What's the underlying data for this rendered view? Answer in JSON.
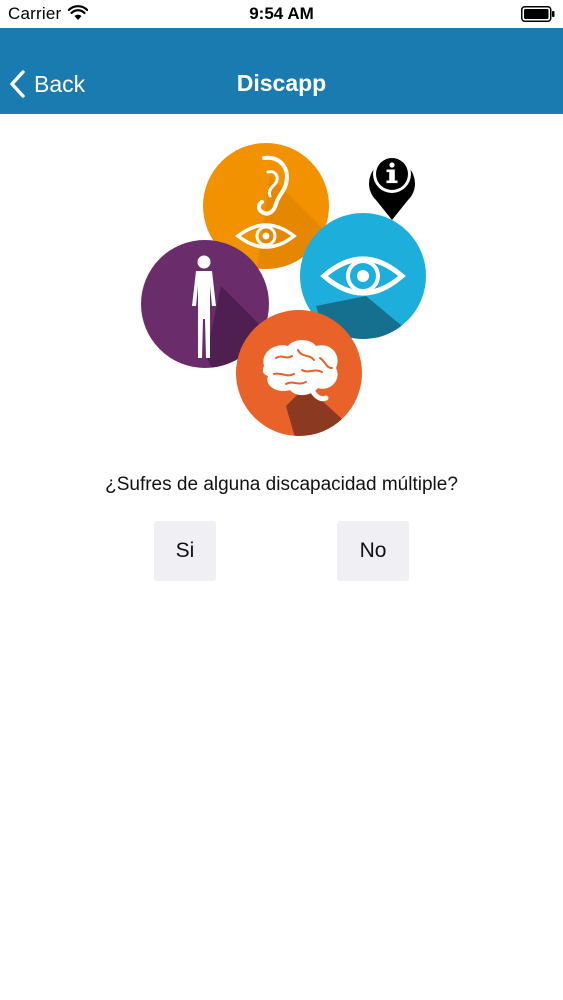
{
  "status_bar": {
    "carrier": "Carrier",
    "time": "9:54 AM",
    "icons": [
      "wifi-icon",
      "battery-icon"
    ]
  },
  "nav": {
    "back_label": "Back",
    "title": "Discapp",
    "background_color": "#1a7bb0"
  },
  "hero": {
    "icons": [
      "ear-icon",
      "eye-icon",
      "human-body-icon",
      "brain-icon",
      "info-pin-icon"
    ],
    "colors": {
      "hearing": "#f39200",
      "visual": "#1eaedb",
      "physical": "#6b2c6b",
      "intellectual": "#e8622a"
    }
  },
  "question": {
    "text": "¿Sufres de alguna discapacidad múltiple?",
    "yes_label": "Si",
    "no_label": "No"
  }
}
